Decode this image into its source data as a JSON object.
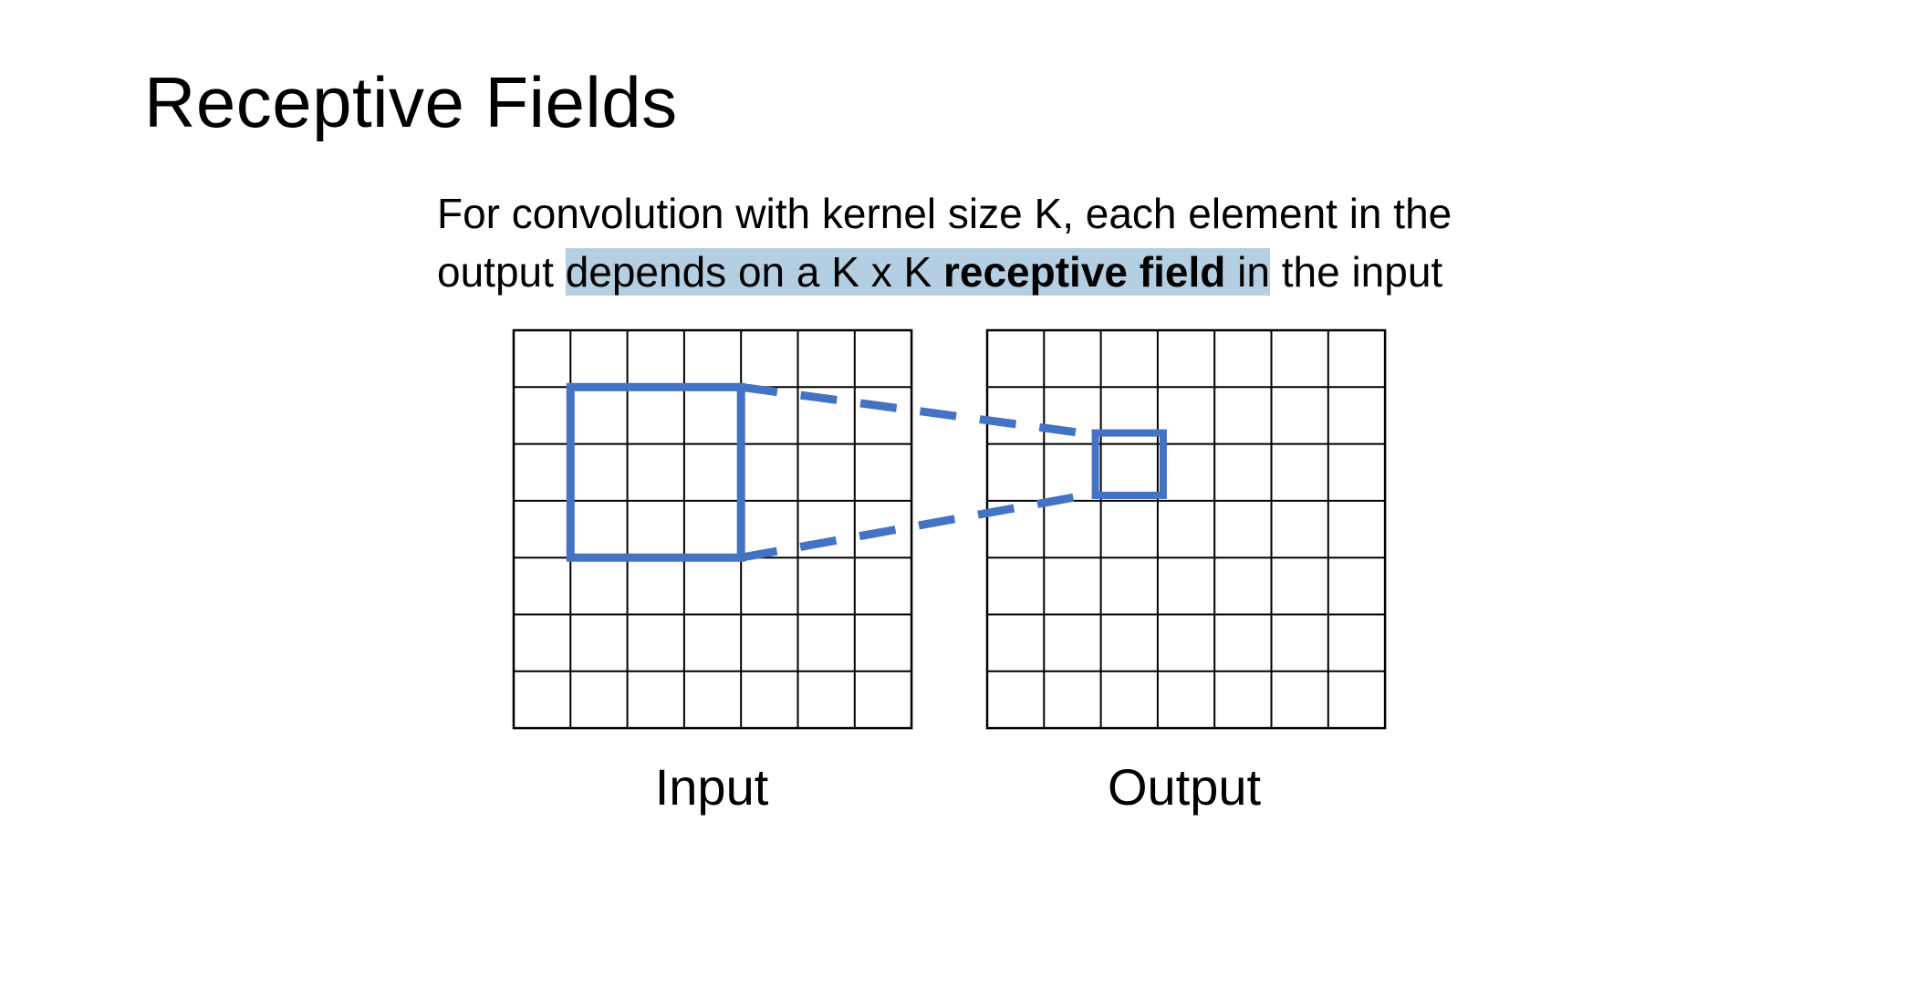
{
  "slide": {
    "title": "Receptive Fields",
    "body": {
      "line1": "For convolution with kernel size K, each element in the",
      "line2_prefix": "output ",
      "line2_highlight_before_bold": "depends on a K x K ",
      "line2_bold": "receptive field",
      "line2_highlight_after_bold": " in",
      "line2_suffix": " the input"
    },
    "highlight_color": "#b4cfe2"
  },
  "diagram": {
    "grid_size": 7,
    "accent_color": "#4472c4",
    "input_grid": {
      "caption": "Input",
      "receptive_field": {
        "row_start": 1,
        "col_start": 1,
        "size": 3
      }
    },
    "output_grid": {
      "caption": "Output",
      "highlighted_cell": {
        "row": 2,
        "col": 2
      }
    },
    "connector": "dashed-lines"
  }
}
